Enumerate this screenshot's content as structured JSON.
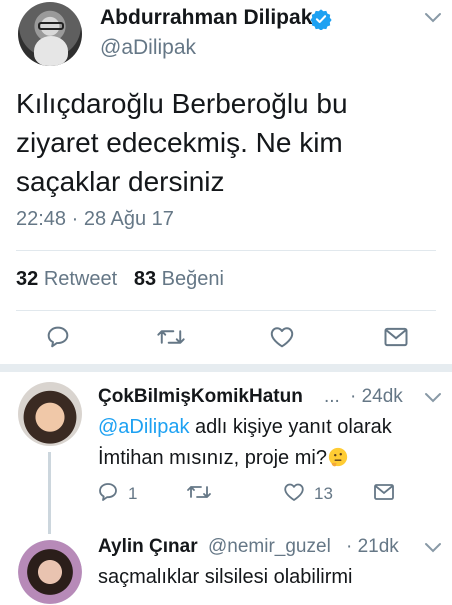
{
  "tweet": {
    "author_name": "Abdurrahman Dilipak",
    "author_handle": "@aDilipak",
    "text": "Kılıçdaroğlu Berberoğlu bu ziyaret edecekmiş. Ne kim saçaklar dersiniz",
    "timestamp": "22:48 · 28 Ağu 17",
    "retweet_count": "32",
    "retweet_label": "Retweet",
    "like_count": "83",
    "like_label": "Beğeni"
  },
  "replies": [
    {
      "name": "ÇokBilmişKomikHatun",
      "ellipsis": "...",
      "time": "· 24dk",
      "reply_to_handle": "@aDilipak",
      "reply_to_suffix": " adlı kişiye yanıt olarak",
      "text": "İmtihan mısınız, proje mi?",
      "reply_count": "1",
      "like_count": "13"
    },
    {
      "name": "Aylin Çınar",
      "handle": "@nemir_guzel",
      "time": "· 21dk",
      "text": "saçmalıklar silsilesi olabilirmi"
    }
  ],
  "colors": {
    "accent": "#1da1f2",
    "secondary_text": "#657786",
    "divider": "#e1e8ed"
  },
  "icons": [
    "verified-badge-icon",
    "chevron-down-icon",
    "reply-icon",
    "retweet-icon",
    "like-icon",
    "share-icon",
    "thinking-face-emoji"
  ]
}
